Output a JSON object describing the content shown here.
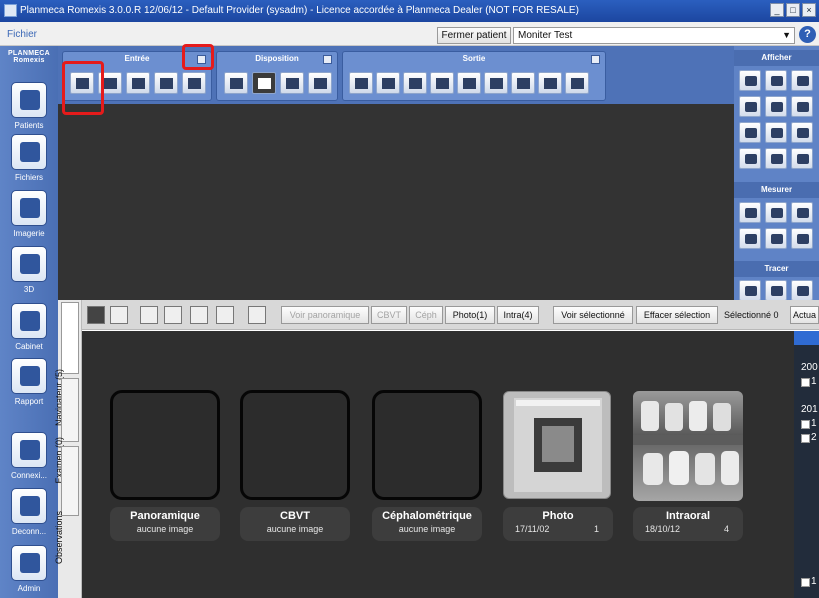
{
  "title": "Planmeca Romexis 3.0.0.R 12/06/12 - Default Provider (sysadm) - Licence accordée à Planmeca Dealer (NOT FOR RESALE)",
  "window_controls": [
    "_",
    "□",
    "×"
  ],
  "menu": {
    "file": "Fichier"
  },
  "patient_bar": {
    "close_patient": "Fermer patient",
    "patient": "Moniter Test"
  },
  "sidebar": {
    "logo": "PLANMECA Romexis",
    "items": [
      {
        "label": "Patients",
        "icon": "patients-icon"
      },
      {
        "label": "Fichiers",
        "icon": "files-icon"
      },
      {
        "label": "Imagerie",
        "icon": "imaging-icon"
      },
      {
        "label": "3D",
        "icon": "3d-icon"
      },
      {
        "label": "Cabinet",
        "icon": "dental-chair-icon"
      },
      {
        "label": "Rapport",
        "icon": "report-icon"
      },
      {
        "label": "Connexi...",
        "icon": "connect-icon"
      },
      {
        "label": "Deconn...",
        "icon": "disconnect-icon"
      },
      {
        "label": "Admin",
        "icon": "admin-icon"
      }
    ]
  },
  "ribbon": {
    "groups": [
      {
        "title": "Entrée"
      },
      {
        "title": "Disposition"
      },
      {
        "title": "Sortie"
      }
    ]
  },
  "right_panel": {
    "display": "Afficher",
    "measure": "Mesurer",
    "trace": "Tracer"
  },
  "lower_toolbar": {
    "view_panoramic": "Voir panoramique",
    "cbvt": "CBVT",
    "ceph": "Céph",
    "photo": "Photo(1)",
    "intra": "Intra(4)",
    "view_selected": "Voir sélectionné",
    "clear_selection": "Effacer sélection",
    "selected": "Sélectionné 0",
    "refresh": "Actua"
  },
  "vertical_tabs": [
    "Navigateur (5)",
    "Examen (0)",
    "Observations"
  ],
  "thumbnails": [
    {
      "name": "Panoramique",
      "sub": "aucune image",
      "count": ""
    },
    {
      "name": "CBVT",
      "sub": "aucune image",
      "count": ""
    },
    {
      "name": "Céphalométrique",
      "sub": "aucune image",
      "count": ""
    },
    {
      "name": "Photo",
      "sub": "17/11/02",
      "count": "1"
    },
    {
      "name": "Intraoral",
      "sub": "18/10/12",
      "count": "4"
    }
  ],
  "right_list": {
    "y1": "200",
    "y2": "201",
    "c1": "1",
    "c2": "1",
    "c3": "2",
    "c4": "1"
  },
  "colors": {
    "highlight": "#e51b1b",
    "ribbon": "#4e72b7",
    "workspace": "#333333"
  }
}
